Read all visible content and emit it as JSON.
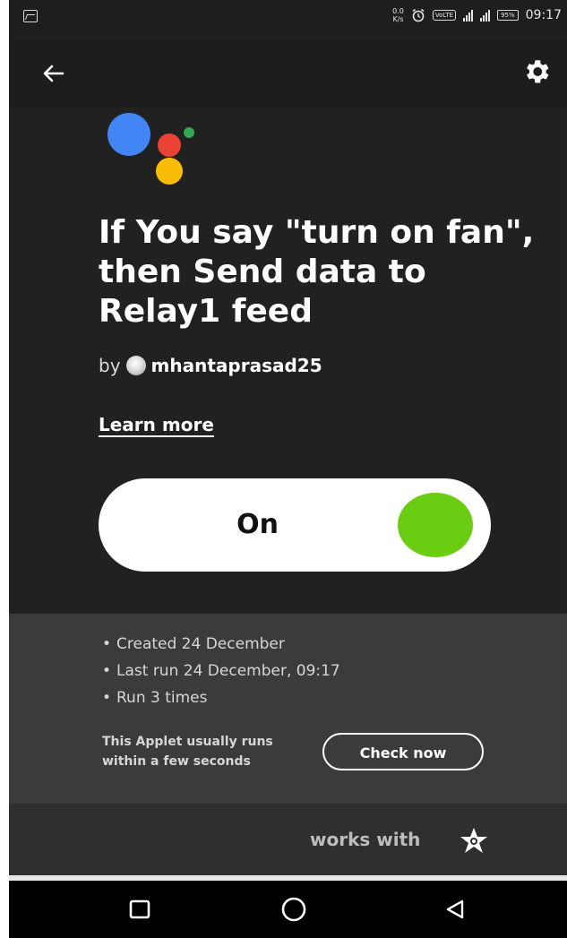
{
  "status_bar": {
    "speed_value": "0.0",
    "speed_unit": "K/s",
    "volte": "VoLTE",
    "battery": "95%",
    "time": "09:17"
  },
  "header": {
    "back_icon": "arrow-left-icon",
    "settings_icon": "gear-icon"
  },
  "applet": {
    "service_icon": "google-assistant-icon",
    "title": "If You say \"turn on fan\", then Send data to Relay1 feed",
    "by_label": "by",
    "author": "mhantaprasad25",
    "learn_more": "Learn more",
    "toggle_label": "On",
    "toggle_state": "on",
    "toggle_color": "#6acd12"
  },
  "details": {
    "items": [
      "Created 24 December",
      "Last run 24 December, 09:17",
      "Run 3 times"
    ],
    "run_note": "This Applet usually runs within a few seconds",
    "check_now": "Check now"
  },
  "works_with": {
    "label": "works with",
    "icon": "adafruit-star-icon"
  },
  "nav_bar": {
    "recent_icon": "square-recent-apps-icon",
    "home_icon": "circle-home-icon",
    "back_icon": "triangle-back-icon"
  },
  "colors": {
    "hero_bg": "#212121",
    "details_bg": "#3b3b3b",
    "accent_green": "#6acd12"
  }
}
